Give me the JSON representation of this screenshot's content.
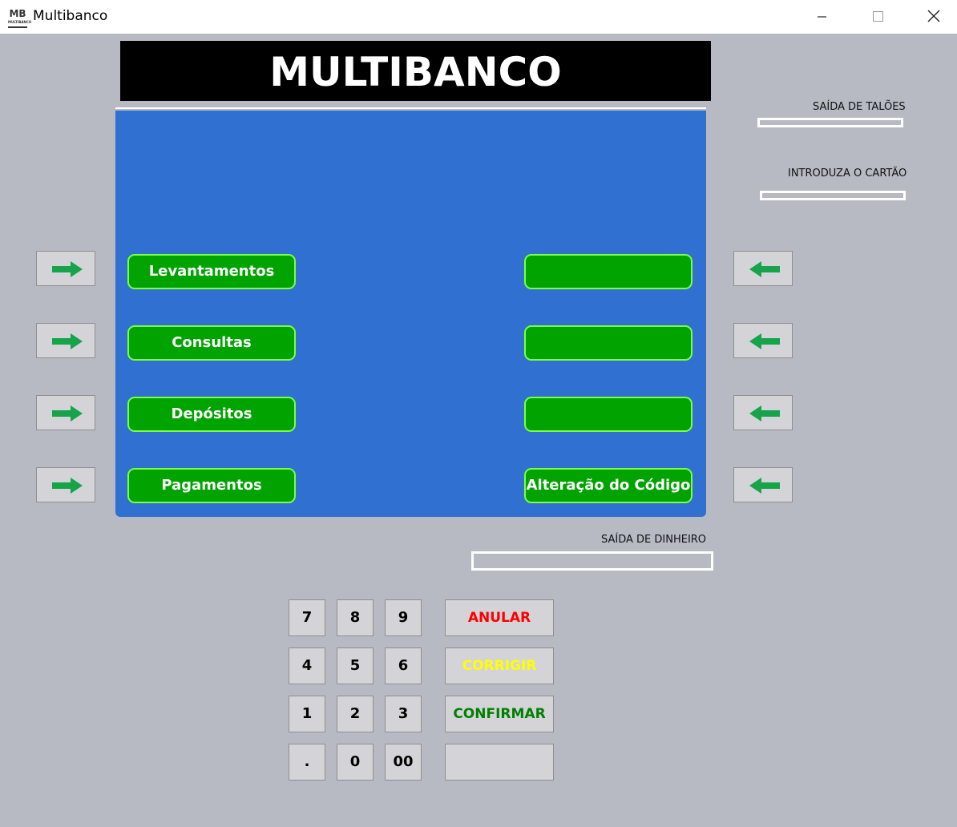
{
  "window": {
    "icon_text": "MB",
    "icon_subtext": "MULTIBANCO",
    "title": "Multibanco"
  },
  "banner": {
    "title": "MULTIBANCO"
  },
  "menu": {
    "left": [
      "Levantamentos",
      "Consultas",
      "Depósitos",
      "Pagamentos"
    ],
    "right": [
      "",
      "",
      "",
      "Alteração do Código"
    ]
  },
  "slots": {
    "receipt_label": "SAÍDA DE TALÕES",
    "card_label": "INTRODUZA O CARTÃO",
    "cash_label": "SAÍDA DE DINHEIRO"
  },
  "keypad": {
    "keys": [
      "7",
      "8",
      "9",
      "4",
      "5",
      "6",
      "1",
      "2",
      "3",
      ".",
      "0",
      "00"
    ],
    "cancel": "ANULAR",
    "correct": "CORRIGIR",
    "confirm": "CONFIRMAR",
    "blank": ""
  },
  "colors": {
    "background": "#b7bac3",
    "screen": "#3070d0",
    "menu_button": "#00a300",
    "menu_border": "#7dff43",
    "arrow": "#16a34a",
    "cancel": "#ff0000",
    "correct": "#ffff00",
    "confirm": "#008000"
  },
  "icons": {
    "left_side_buttons": "arrow-right-icon",
    "right_side_buttons": "arrow-left-icon"
  }
}
